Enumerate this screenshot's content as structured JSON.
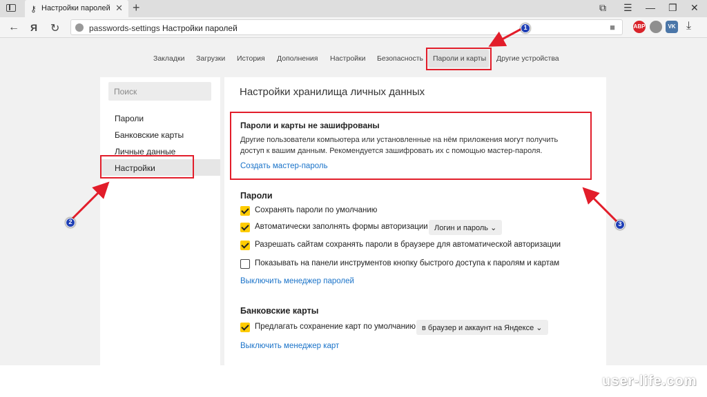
{
  "browser": {
    "tab_title": "Настройки паролей",
    "tab_close": "✕",
    "new_tab": "+",
    "url": "passwords-settings",
    "url_title": "Настройки паролей",
    "back": "←",
    "logo": "Я",
    "reload": "↻",
    "bookmark": "■",
    "download": "⤓",
    "window_controls": [
      "⧉",
      "☰",
      "—",
      "❐",
      "✕"
    ],
    "extensions": [
      {
        "label": "ABP",
        "color": "#d9232a"
      },
      {
        "label": "",
        "color": "#8f8f8f"
      },
      {
        "label": "VK",
        "color": "#4a76a8"
      }
    ]
  },
  "topnav": {
    "items": [
      "Закладки",
      "Загрузки",
      "История",
      "Дополнения",
      "Настройки",
      "Безопасность",
      "Пароли и карты",
      "Другие устройства"
    ]
  },
  "sidebar": {
    "search_placeholder": "Поиск",
    "items": [
      "Пароли",
      "Банковские карты",
      "Личные данные",
      "Настройки"
    ]
  },
  "main": {
    "title": "Настройки хранилища личных данных",
    "warning": {
      "title": "Пароли и карты не зашифрованы",
      "text": "Другие пользователи компьютера или установленные на нём приложения могут получить доступ к вашим данным. Рекомендуется зашифровать их с помощью мастер-пароля.",
      "link": "Создать мастер-пароль"
    },
    "passwords": {
      "title": "Пароли",
      "options": [
        {
          "label": "Сохранять пароли по умолчанию",
          "checked": true
        },
        {
          "label": "Автоматически заполнять формы авторизации",
          "checked": true
        },
        {
          "label": "Разрешать сайтам сохранять пароли в браузере для автоматической авторизации",
          "checked": true
        },
        {
          "label": "Показывать на панели инструментов кнопку быстрого доступа к паролям и картам",
          "checked": false
        }
      ],
      "autofill_select": "Логин и пароль  ⌄",
      "disable_link": "Выключить менеджер паролей"
    },
    "cards": {
      "title": "Банковские карты",
      "option": {
        "label": "Предлагать сохранение карт по умолчанию",
        "checked": true
      },
      "select": "в браузер и аккаунт на Яндексе  ⌄",
      "disable_link": "Выключить менеджер карт"
    }
  },
  "annotations": {
    "badges": [
      "1",
      "2",
      "3"
    ],
    "color": "#e21d2a"
  },
  "watermark": "user-life.com"
}
